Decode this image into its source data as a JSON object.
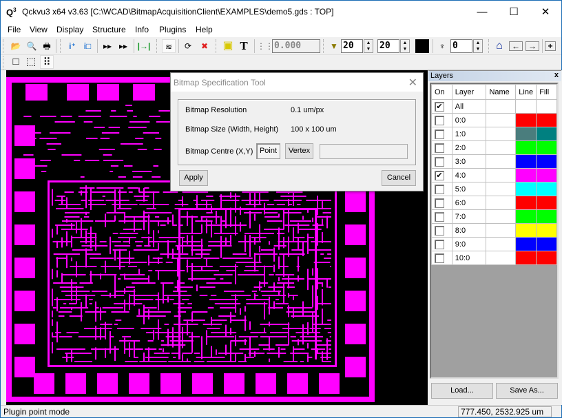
{
  "window": {
    "title": "Qckvu3 x64 v3.63 [C:\\WCAD\\BitmapAcquisitionClient\\EXAMPLES\\demo5.gds : TOP]",
    "app_icon": "Q",
    "minimize": "—",
    "maximize": "☐",
    "close": "✕"
  },
  "menu": [
    "File",
    "View",
    "Display",
    "Structure",
    "Info",
    "Plugins",
    "Help"
  ],
  "toolbar": {
    "icons": {
      "open": "📂",
      "print_preview": "🔍",
      "print": "🖶",
      "info_add": "i⁺",
      "info_box": "i□",
      "step_into": "▸▸",
      "step_over": "▸▸",
      "fit": "|→|",
      "layers": "≋",
      "refresh": "⟳",
      "stop": "✖",
      "fill_toggle": "▣",
      "text": "T",
      "grid": "⋮⋮",
      "filter": "▼",
      "hierarchy": "♆",
      "home": "⌂",
      "back": "←",
      "forward": "→",
      "zoom_in": "+"
    },
    "grid_value": "0.000",
    "filter_min": "20",
    "filter_max": "20",
    "depth": "0",
    "color_swatch": "#000000",
    "select_modes": [
      "□",
      "⬚",
      "⠿"
    ]
  },
  "dialog": {
    "title": "Bitmap Specification Tool",
    "close": "✕",
    "resolution_label": "Bitmap Resolution",
    "resolution_value": "0.1 um/px",
    "size_label": "Bitmap Size (Width, Height)",
    "size_value": "100 x 100 um",
    "centre_label": "Bitmap Centre (X,Y)",
    "point_button": "Point",
    "vertex_button": "Vertex",
    "centre_value": "",
    "apply_button": "Apply",
    "cancel_button": "Cancel"
  },
  "layers_panel": {
    "title": "Layers",
    "close": "x",
    "columns": [
      "On",
      "Layer",
      "Name",
      "Line",
      "Fill"
    ],
    "rows": [
      {
        "on": true,
        "layer": "All",
        "name": "",
        "line": "",
        "fill": ""
      },
      {
        "on": false,
        "layer": "0:0",
        "name": "",
        "line": "#ff0000",
        "fill": "#ff0000"
      },
      {
        "on": false,
        "layer": "1:0",
        "name": "",
        "line": "#4a7d7d",
        "fill": "#008080"
      },
      {
        "on": false,
        "layer": "2:0",
        "name": "",
        "line": "#00ff00",
        "fill": "#00ff00"
      },
      {
        "on": false,
        "layer": "3:0",
        "name": "",
        "line": "#0000ff",
        "fill": "#0000ff"
      },
      {
        "on": true,
        "layer": "4:0",
        "name": "",
        "line": "#ff00ff",
        "fill": "#ff00ff"
      },
      {
        "on": false,
        "layer": "5:0",
        "name": "",
        "line": "#00ffff",
        "fill": "#00ffff"
      },
      {
        "on": false,
        "layer": "6:0",
        "name": "",
        "line": "#ff0000",
        "fill": "#ff0000"
      },
      {
        "on": false,
        "layer": "7:0",
        "name": "",
        "line": "#00ff00",
        "fill": "#00ff00"
      },
      {
        "on": false,
        "layer": "8:0",
        "name": "",
        "line": "#ffff00",
        "fill": "#ffff00"
      },
      {
        "on": false,
        "layer": "9:0",
        "name": "",
        "line": "#0000ff",
        "fill": "#0000ff"
      },
      {
        "on": false,
        "layer": "10:0",
        "name": "",
        "line": "#ff0000",
        "fill": "#ff0000"
      }
    ],
    "load_button": "Load...",
    "save_button": "Save As..."
  },
  "status": {
    "mode": "Plugin point mode",
    "coordinates": "777.450, 2532.925 um"
  },
  "colors": {
    "layout_layer": "#ff00ff",
    "canvas_bg": "#000000"
  }
}
